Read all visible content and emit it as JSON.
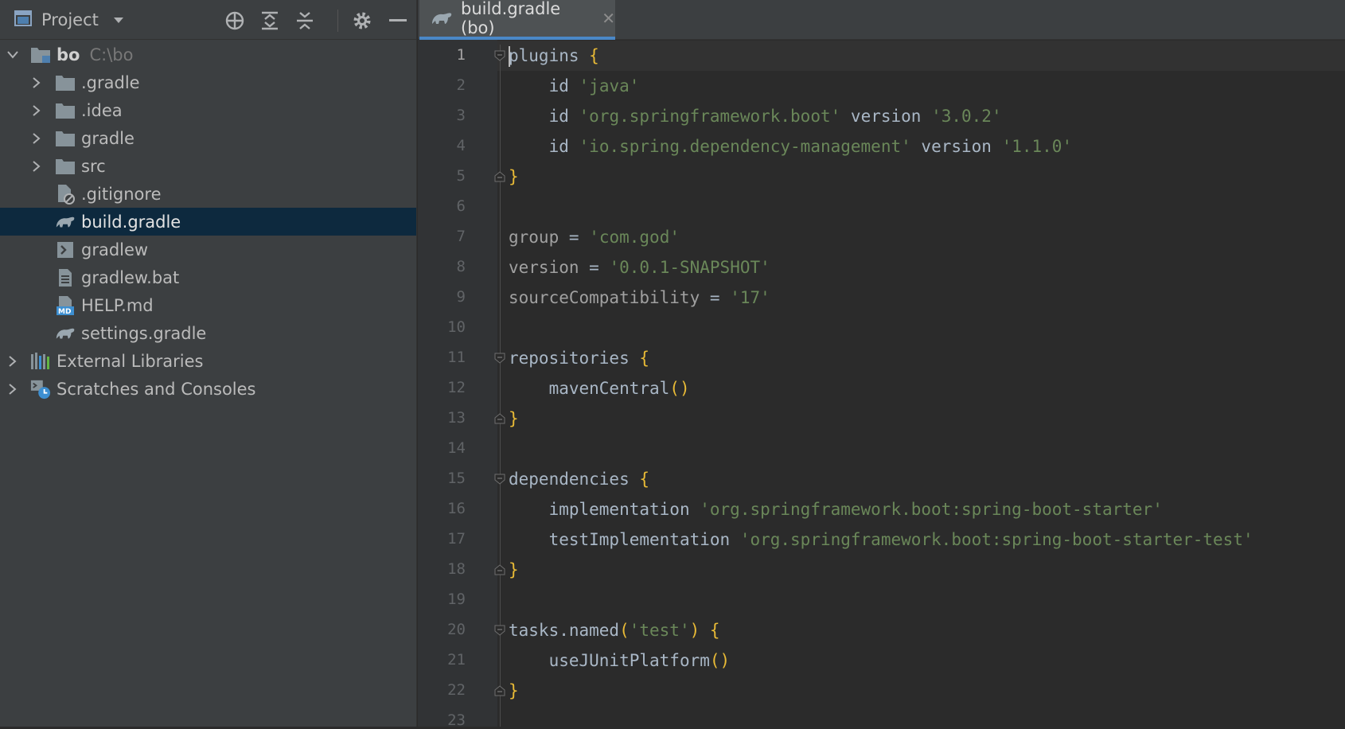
{
  "project_panel": {
    "title": "Project",
    "tree": [
      {
        "label": "bo",
        "path": "C:\\bo",
        "expanded": true,
        "icon": "module-folder-icon"
      },
      {
        "label": ".gradle",
        "icon": "folder-icon"
      },
      {
        "label": ".idea",
        "icon": "folder-icon"
      },
      {
        "label": "gradle",
        "icon": "folder-icon"
      },
      {
        "label": "src",
        "icon": "folder-icon"
      },
      {
        "label": ".gitignore",
        "icon": "ignore-file-icon"
      },
      {
        "label": "build.gradle",
        "icon": "gradle-icon",
        "selected": true
      },
      {
        "label": "gradlew",
        "icon": "shell-script-icon"
      },
      {
        "label": "gradlew.bat",
        "icon": "text-file-icon"
      },
      {
        "label": "HELP.md",
        "icon": "markdown-icon"
      },
      {
        "label": "settings.gradle",
        "icon": "gradle-icon"
      },
      {
        "label": "External Libraries",
        "icon": "libraries-icon"
      },
      {
        "label": "Scratches and Consoles",
        "icon": "scratches-icon"
      }
    ]
  },
  "editor": {
    "tab_label": "build.gradle (bo)",
    "line_numbers": [
      "1",
      "2",
      "3",
      "4",
      "5",
      "6",
      "7",
      "8",
      "9",
      "10",
      "11",
      "12",
      "13",
      "14",
      "15",
      "16",
      "17",
      "18",
      "19",
      "20",
      "21",
      "22",
      "23"
    ],
    "code": {
      "l1_kw": "plugins",
      "l1_brace": "{",
      "l2_kw": "id",
      "l2_str": "'java'",
      "l3_kw": "id",
      "l3_str": "'org.springframework.boot'",
      "l3_kw2": "version",
      "l3_str2": "'3.0.2'",
      "l4_kw": "id",
      "l4_str": "'io.spring.dependency-management'",
      "l4_kw2": "version",
      "l4_str2": "'1.1.0'",
      "l5_brace": "}",
      "l7_prop": "group",
      "l7_eq": "=",
      "l7_str": "'com.god'",
      "l8_prop": "version",
      "l8_eq": "=",
      "l8_str": "'0.0.1-SNAPSHOT'",
      "l9_prop": "sourceCompatibility",
      "l9_eq": "=",
      "l9_str": "'17'",
      "l11_kw": "repositories",
      "l11_brace": "{",
      "l12_kw": "mavenCentral",
      "l12_par": "()",
      "l13_brace": "}",
      "l15_kw": "dependencies",
      "l15_brace": "{",
      "l16_kw": "implementation",
      "l16_str": "'org.springframework.boot:spring-boot-starter'",
      "l17_kw": "testImplementation",
      "l17_str": "'org.springframework.boot:spring-boot-starter-test'",
      "l18_brace": "}",
      "l20_kw": "tasks.named",
      "l20_par1": "(",
      "l20_str": "'test'",
      "l20_par2": ")",
      "l20_brace": "{",
      "l21_kw": "useJUnitPlatform",
      "l21_par": "()",
      "l22_brace": "}"
    }
  },
  "colors": {
    "panel_bg": "#3c3f41",
    "editor_bg": "#2b2b2b",
    "selection": "#0d293e",
    "string": "#6a8759",
    "brace": "#e8ba36",
    "tab_underline": "#4a88c7"
  }
}
